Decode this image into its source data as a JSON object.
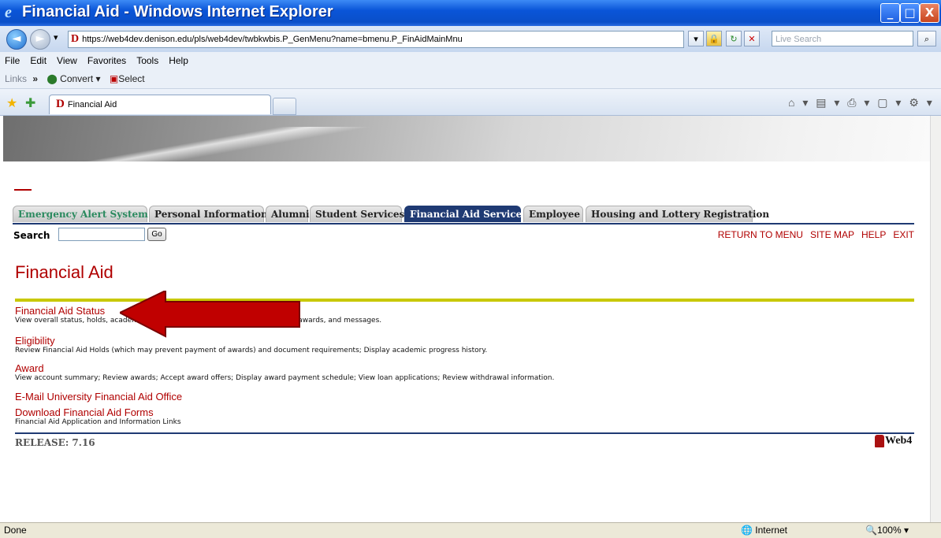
{
  "window": {
    "title": "Financial Aid - Windows Internet Explorer",
    "ie_logo": "e",
    "minimize": "_",
    "maximize": "□",
    "close": "X"
  },
  "address_bar": {
    "back": "◄",
    "forward": "►",
    "dropdown": "▾",
    "site_logo": "D",
    "url": "https://web4dev.denison.edu/pls/web4dev/twbkwbis.P_GenMenu?name=bmenu.P_FinAidMainMnu",
    "refresh": "↻",
    "stop": "✕",
    "search_placeholder": "Live Search",
    "search_icon": "⌕"
  },
  "menu_bar": {
    "items": [
      "File",
      "Edit",
      "View",
      "Favorites",
      "Tools",
      "Help"
    ]
  },
  "links_bar": {
    "label": "Links",
    "chevron": "»",
    "convert": "Convert",
    "select": "Select"
  },
  "tab_bar": {
    "tab_logo": "D",
    "tab_title": "Financial Aid",
    "tool_icons": "⌂ ▾ ▤ ▾ ⎙ ▾ ▢ ▾ ⚙ ▾"
  },
  "page": {
    "tabs": [
      {
        "label": "Emergency Alert System",
        "style": "green"
      },
      {
        "label": "Personal Information"
      },
      {
        "label": "Alumni"
      },
      {
        "label": "Student Services"
      },
      {
        "label": "Financial Aid Services",
        "style": "active"
      },
      {
        "label": "Employee"
      },
      {
        "label": "Housing and Lottery Registration"
      }
    ],
    "search_label": "Search",
    "search_value": "",
    "go_label": "Go",
    "top_links": [
      "RETURN TO MENU",
      "SITE MAP",
      "HELP",
      "EXIT"
    ],
    "title": "Financial Aid",
    "menu_items": [
      {
        "label": "Financial Aid Status",
        "description": "View overall status, holds, academic progress, cost of attendance, financial aid awards, and messages."
      },
      {
        "label": "Eligibility",
        "description": "Review Financial Aid Holds (which may prevent payment of awards) and document requirements; Display academic progress history."
      },
      {
        "label": "Award",
        "description": "View account summary; Review awards; Accept award offers; Display award payment schedule; View loan applications; Review withdrawal information."
      },
      {
        "label": "E-Mail University Financial Aid Office",
        "description": ""
      },
      {
        "label": "Download Financial Aid Forms",
        "description": "Financial Aid Application and Information Links"
      }
    ],
    "release": "RELEASE: 7.16",
    "web4_logo": "Web4"
  },
  "status_bar": {
    "left": "Done",
    "zone": "Internet",
    "zoom": "100%"
  },
  "colors": {
    "link": "#b00000",
    "accent_navy": "#1f3a73",
    "rule_yellow": "#c8c800",
    "arrow_red": "#c00000"
  }
}
